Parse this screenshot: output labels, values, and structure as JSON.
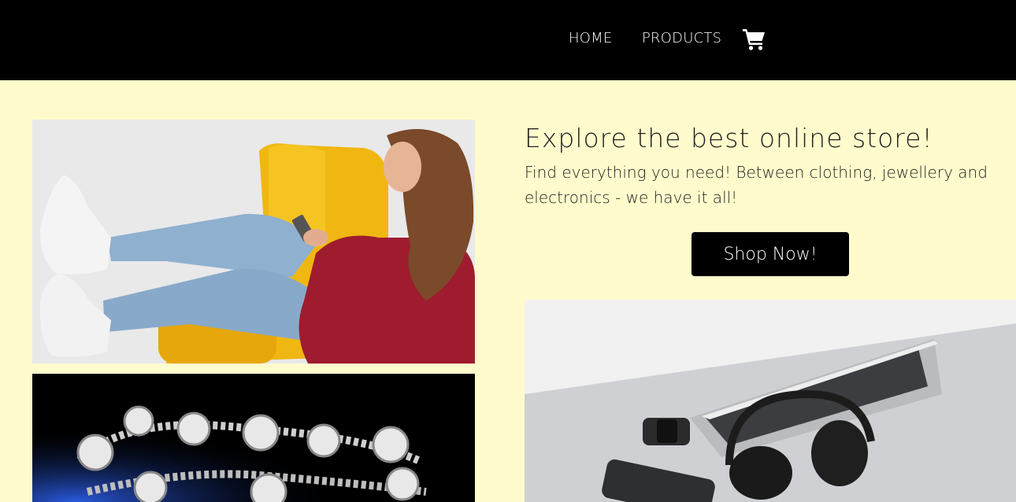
{
  "nav": {
    "home_label": "HOME",
    "products_label": "PRODUCTS",
    "cart_icon": "shopping-cart-icon"
  },
  "hero": {
    "title": "Explore the best online store!",
    "subtitle": "Find everything you need! Between clothing, jewellery and electronics - we have it all!",
    "button_label": "Shop Now!"
  },
  "images": {
    "clothing": "woman-in-yellow-chair-photo",
    "jewellery": "diamond-bracelet-photo",
    "electronics": "laptop-headphones-phone-photo"
  },
  "colors": {
    "background": "#fffbcc",
    "header": "#000000",
    "button": "#000000"
  }
}
